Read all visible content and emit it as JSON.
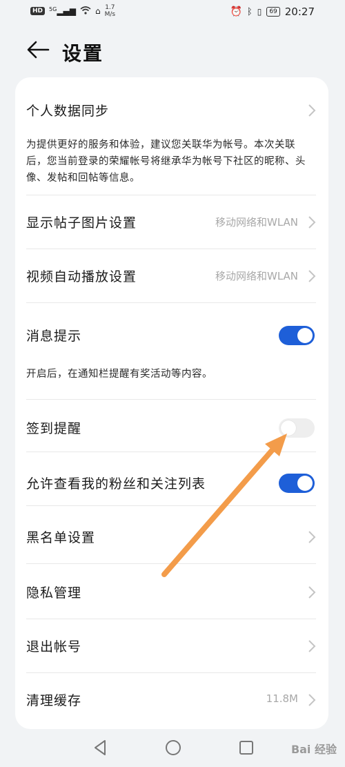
{
  "status_bar": {
    "hd_badge": "HD",
    "network": "5G",
    "speed_value": "1.7",
    "speed_unit": "M/s",
    "battery": "69",
    "time": "20:27"
  },
  "header": {
    "title": "设置"
  },
  "settings": {
    "sync": {
      "title": "个人数据同步",
      "description": "为提供更好的服务和体验，建议您关联华为帐号。本次关联后，您当前登录的荣耀帐号将继承华为帐号下社区的昵称、头像、发帖和回帖等信息。"
    },
    "post_image": {
      "title": "显示帖子图片设置",
      "value": "移动网络和WLAN"
    },
    "video_autoplay": {
      "title": "视频自动播放设置",
      "value": "移动网络和WLAN"
    },
    "message_alert": {
      "title": "消息提示",
      "enabled": true,
      "description": "开启后，在通知栏提醒有奖活动等内容。"
    },
    "checkin_reminder": {
      "title": "签到提醒",
      "enabled": false
    },
    "fans_visibility": {
      "title": "允许查看我的粉丝和关注列表",
      "enabled": true
    },
    "blacklist": {
      "title": "黑名单设置"
    },
    "privacy": {
      "title": "隐私管理"
    },
    "logout": {
      "title": "退出帐号"
    },
    "clear_cache": {
      "title": "清理缓存",
      "value": "11.8M"
    }
  },
  "watermark": {
    "text": "Bai 经验"
  },
  "colors": {
    "toggle_on": "#1e5fd8",
    "toggle_off": "#eeeeee",
    "annotation_arrow": "#f39c4a",
    "background": "#f1f3f5"
  }
}
